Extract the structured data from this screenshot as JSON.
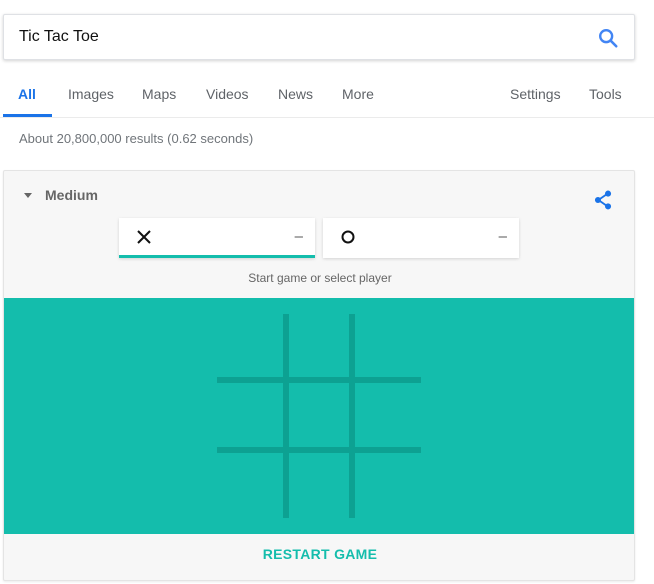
{
  "search": {
    "query": "Tic Tac Toe"
  },
  "tabs": [
    {
      "label": "All"
    },
    {
      "label": "Images"
    },
    {
      "label": "Maps"
    },
    {
      "label": "Videos"
    },
    {
      "label": "News"
    },
    {
      "label": "More"
    },
    {
      "label": "Settings"
    },
    {
      "label": "Tools"
    }
  ],
  "active_tab": "All",
  "result_stats": "About 20,800,000 results (0.62 seconds)",
  "game": {
    "difficulty": "Medium",
    "players": [
      {
        "mark": "X",
        "score": "–",
        "selected": true
      },
      {
        "mark": "O",
        "score": "–",
        "selected": false
      }
    ],
    "status": "Start game or select player",
    "restart_label": "RESTART GAME",
    "board": [
      "",
      "",
      "",
      "",
      "",
      "",
      "",
      "",
      ""
    ]
  },
  "colors": {
    "accent_blue": "#1a73e8",
    "board_teal": "#14bdac",
    "grid_line": "#0da192"
  },
  "icons": {
    "search": "search-icon",
    "share": "share-icon",
    "caret": "caret-down-icon"
  }
}
